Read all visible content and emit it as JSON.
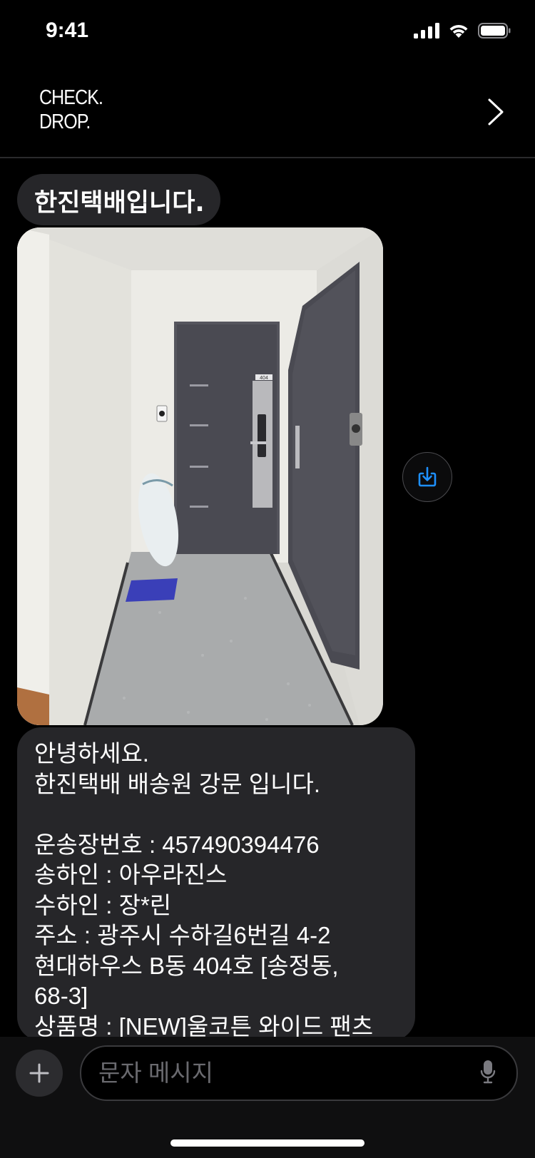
{
  "status": {
    "time": "9:41"
  },
  "header": {
    "logo_line1": "CHECK.",
    "logo_line2": "DROP."
  },
  "messages": [
    {
      "text": "한진택배입니다."
    },
    {
      "text": "안녕하세요.\n한진택배 배송원 강문 입니다.\n\n운송장번호 : 457490394476\n송하인 : 아우라진스\n수하인 : 장*린\n주소 : 광주시 수하길6번길 4-2\n현대하우스 B동 404호 [송정동,\n68-3]\n상품명 : [NEW]울코튼 와이드 팬츠"
    }
  ],
  "photo": {
    "door_number": "404"
  },
  "composer": {
    "placeholder": "문자 메시지"
  },
  "colors": {
    "accent": "#1e90ff",
    "bubble": "#262629",
    "background": "#000000"
  },
  "icons": [
    "signal-icon",
    "wifi-icon",
    "battery-icon",
    "chevron-right-icon",
    "save-download-icon",
    "plus-icon",
    "mic-icon"
  ]
}
